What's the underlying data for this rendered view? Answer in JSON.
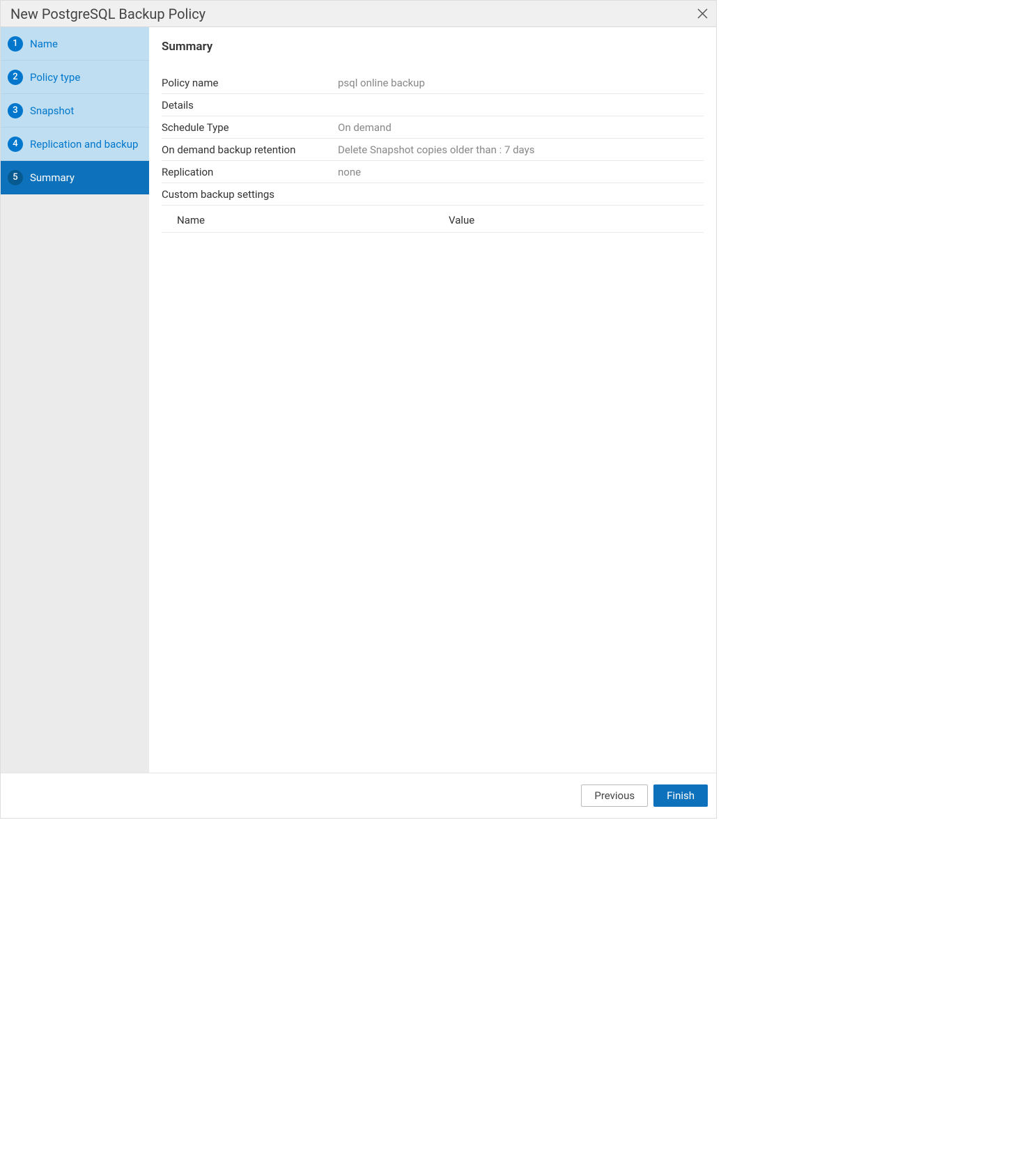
{
  "header": {
    "title": "New PostgreSQL Backup Policy"
  },
  "sidebar": {
    "steps": [
      {
        "num": "1",
        "label": "Name"
      },
      {
        "num": "2",
        "label": "Policy type"
      },
      {
        "num": "3",
        "label": "Snapshot"
      },
      {
        "num": "4",
        "label": "Replication and backup"
      },
      {
        "num": "5",
        "label": "Summary"
      }
    ]
  },
  "content": {
    "title": "Summary",
    "rows": [
      {
        "label": "Policy name",
        "value": "psql online backup"
      },
      {
        "label": "Details",
        "value": ""
      },
      {
        "label": "Schedule Type",
        "value": "On demand"
      },
      {
        "label": "On demand backup retention",
        "value": "Delete Snapshot copies older than : 7 days"
      },
      {
        "label": "Replication",
        "value": "none"
      },
      {
        "label": "Custom backup settings",
        "value": ""
      }
    ],
    "table": {
      "col_name": "Name",
      "col_value": "Value"
    }
  },
  "footer": {
    "previous": "Previous",
    "finish": "Finish"
  }
}
